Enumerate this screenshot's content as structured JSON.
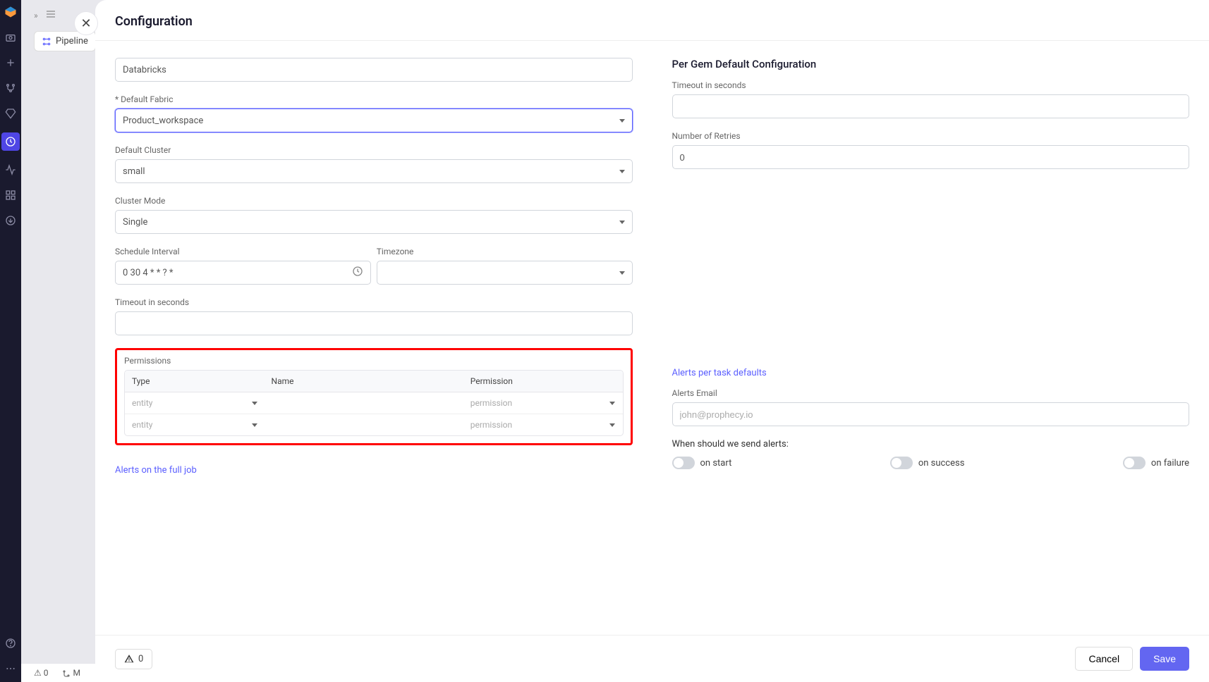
{
  "modal": {
    "title": "Configuration",
    "provider_label": "Databricks",
    "default_fabric_label": "* Default Fabric",
    "default_fabric_value": "Product_workspace",
    "default_cluster_label": "Default Cluster",
    "default_cluster_value": "small",
    "cluster_mode_label": "Cluster Mode",
    "cluster_mode_value": "Single",
    "schedule_label": "Schedule Interval",
    "schedule_value": "0 30 4 * * ? *",
    "timezone_label": "Timezone",
    "timezone_value": "",
    "timeout_label": "Timeout in seconds",
    "timeout_value": "",
    "permissions_label": "Permissions",
    "perm_cols": {
      "type": "Type",
      "name": "Name",
      "perm": "Permission"
    },
    "perm_rows": [
      {
        "type_placeholder": "entity",
        "name": "",
        "perm_placeholder": "permission"
      },
      {
        "type_placeholder": "entity",
        "name": "",
        "perm_placeholder": "permission"
      }
    ],
    "alerts_full_job": "Alerts on the full job"
  },
  "right": {
    "section_title": "Per Gem Default Configuration",
    "timeout_label": "Timeout in seconds",
    "timeout_value": "",
    "retries_label": "Number of Retries",
    "retries_value": "0",
    "alerts_task_defaults": "Alerts per task defaults",
    "alerts_email_label": "Alerts Email",
    "alerts_email_placeholder": "john@prophecy.io",
    "send_alerts_label": "When should we send alerts:",
    "toggles": {
      "on_start": "on start",
      "on_success": "on success",
      "on_failure": "on failure"
    }
  },
  "footer": {
    "warn_count": "0",
    "cancel": "Cancel",
    "save": "Save"
  },
  "backdrop": {
    "expand": "»",
    "pipeline_tab": "Pipeline",
    "status_warn": "0",
    "status_branch": "M"
  }
}
